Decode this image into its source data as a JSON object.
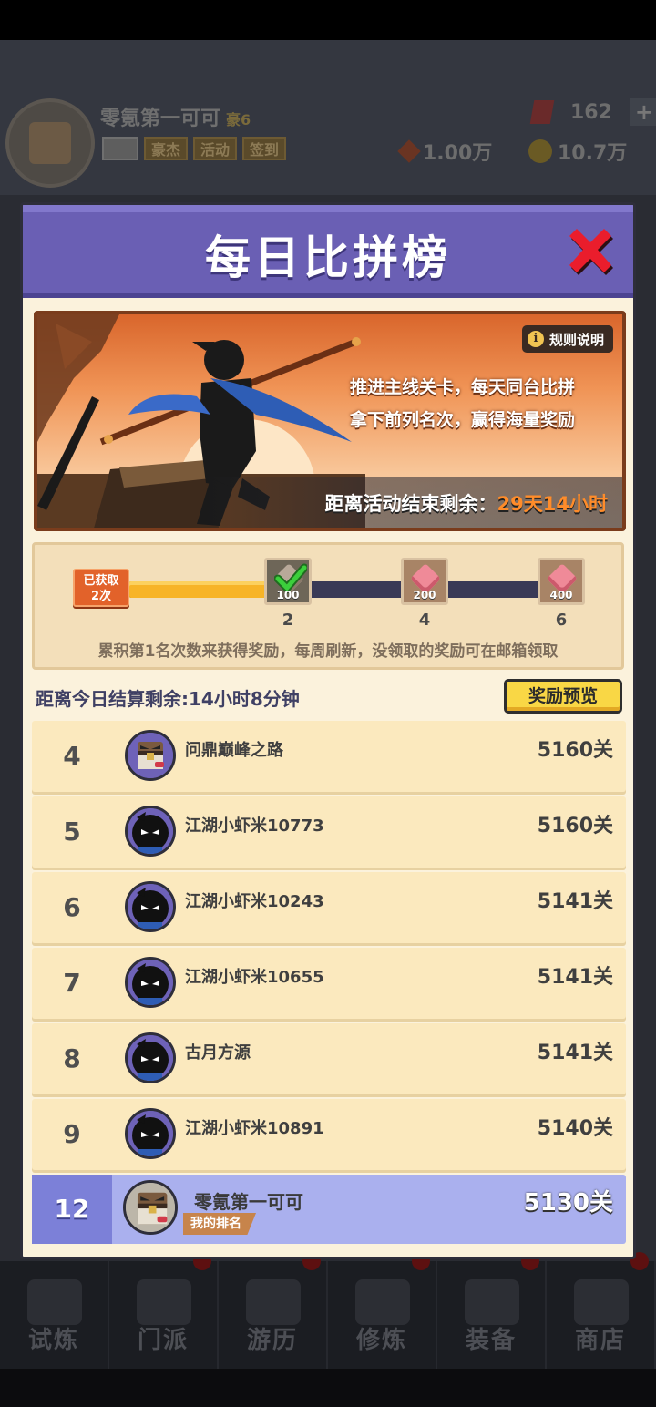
{
  "background": {
    "player_name": "零氪第一可可",
    "vip_label": "豪6",
    "badges": [
      "豪杰",
      "活动",
      "签到"
    ],
    "gems": "162",
    "silver": "1.00万",
    "gold": "10.7万",
    "bottom_tabs": [
      {
        "label": "试炼",
        "icon": "ninja-icon"
      },
      {
        "label": "门派",
        "icon": "temple-icon"
      },
      {
        "label": "游历",
        "icon": "cloud-mountain-icon"
      },
      {
        "label": "修炼",
        "icon": "scroll-book-icon"
      },
      {
        "label": "装备",
        "icon": "swords-icon"
      },
      {
        "label": "商店",
        "icon": "shop-icon"
      }
    ]
  },
  "modal": {
    "title": "每日比拼榜",
    "close_icon": "close-x-icon",
    "accent_header": "#6a5fb4",
    "banner": {
      "rules_label": "规则说明",
      "desc_line1": "推进主线关卡，每天同台比拼",
      "desc_line2": "拿下前列名次，赢得海量奖励",
      "countdown_label": "距离活动结束剩余：",
      "countdown_value": "29天14小时"
    },
    "progress": {
      "got_line1": "已获取",
      "got_line2": "2次",
      "current": 2,
      "max": 6,
      "rewards": [
        {
          "milestone": "2",
          "amount": "100",
          "claimed": true
        },
        {
          "milestone": "4",
          "amount": "200",
          "claimed": false
        },
        {
          "milestone": "6",
          "amount": "400",
          "claimed": false
        }
      ],
      "note": "累积第1名次数来获得奖励，每周刷新，没领取的奖励可在邮箱领取"
    },
    "daily_countdown": "距离今日结算剩余:14小时8分钟",
    "preview_label": "奖励预览",
    "rows": [
      {
        "rank": "4",
        "name": "问鼎巅峰之路",
        "score": "5160关",
        "avatar": "chest"
      },
      {
        "rank": "5",
        "name": "江湖小虾米10773",
        "score": "5160关",
        "avatar": "ninja"
      },
      {
        "rank": "6",
        "name": "江湖小虾米10243",
        "score": "5141关",
        "avatar": "ninja"
      },
      {
        "rank": "7",
        "name": "江湖小虾米10655",
        "score": "5141关",
        "avatar": "ninja"
      },
      {
        "rank": "8",
        "name": "古月方源",
        "score": "5141关",
        "avatar": "ninja"
      },
      {
        "rank": "9",
        "name": "江湖小虾米10891",
        "score": "5140关",
        "avatar": "ninja"
      }
    ],
    "me": {
      "rank": "12",
      "name": "零氪第一可可",
      "score": "5130关",
      "tag": "我的排名"
    }
  }
}
